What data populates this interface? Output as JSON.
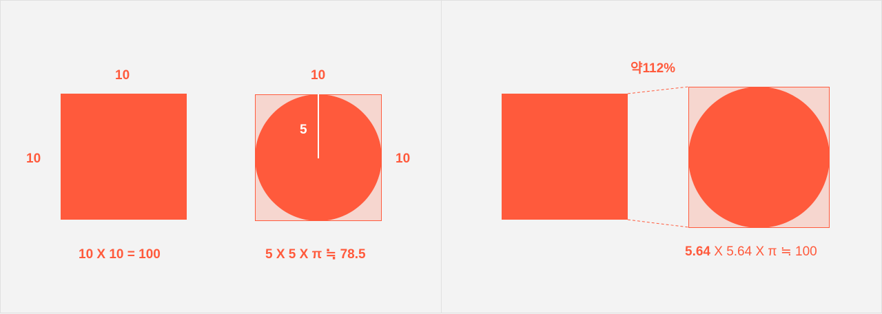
{
  "colors": {
    "accent": "#ff5a3c",
    "accent_light": "#f6d6cf",
    "background": "#f3f3f3",
    "divider": "#dcdcdc"
  },
  "square_diagram": {
    "top_label": "10",
    "side_label": "10",
    "formula": "10 X 10 = 100"
  },
  "circle_diagram": {
    "top_label": "10",
    "side_label": "10",
    "radius_label": "5",
    "formula": "5 X 5 X π ≒ 78.5"
  },
  "comparison_diagram": {
    "percent_label": "약112%",
    "formula_bold": "5.64",
    "formula_rest": " X 5.64 X π ≒ 100"
  }
}
